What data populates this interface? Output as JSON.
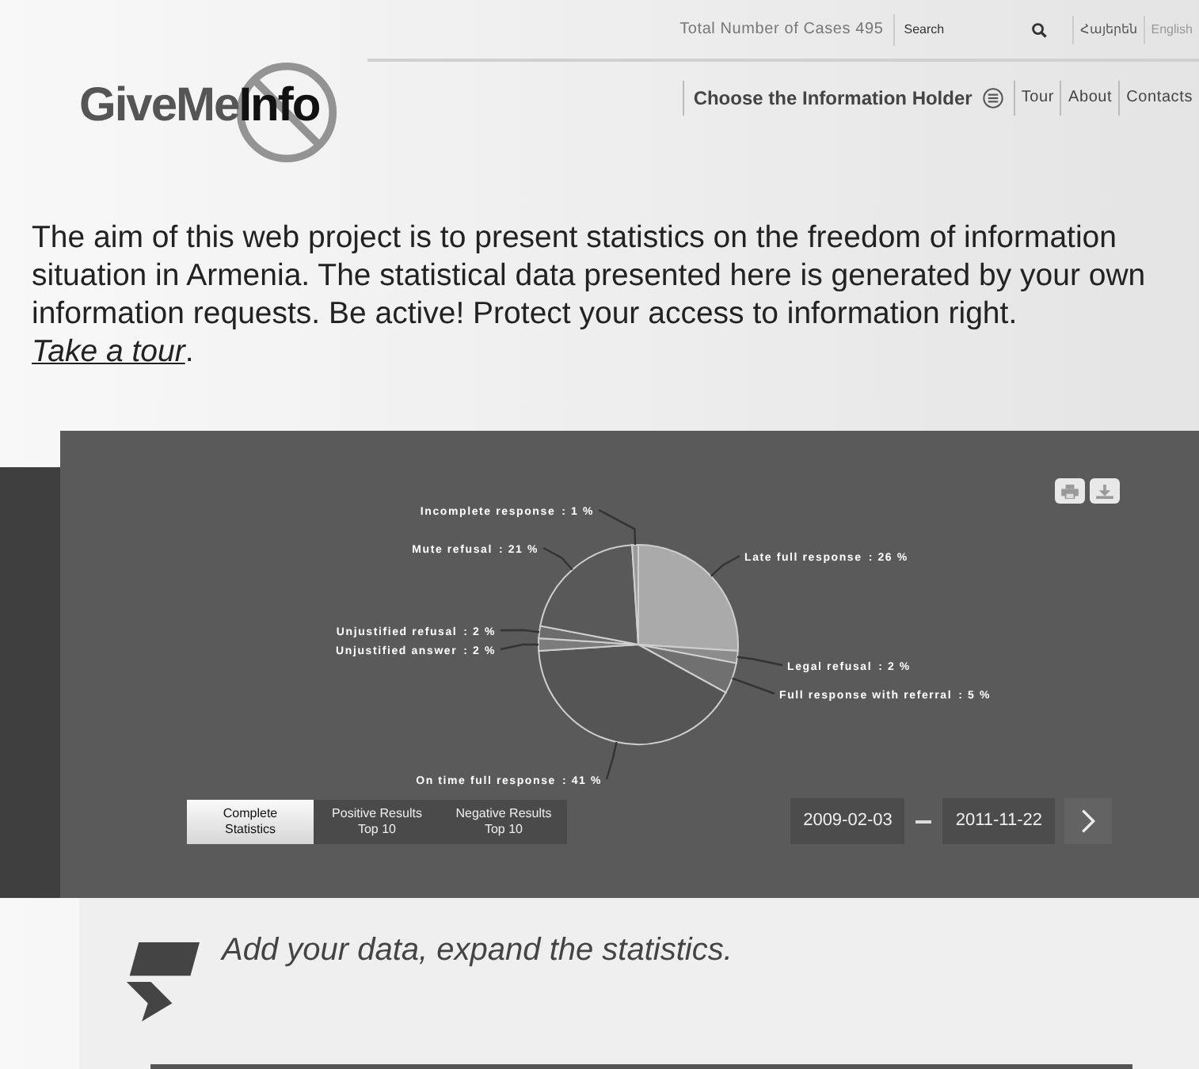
{
  "header": {
    "logo": "GiveMe**Info**",
    "cases": "Total Number of Cases 495",
    "search": {
      "placeholder": "Search"
    },
    "languages": [
      {
        "label": "Հայերեն",
        "selected": false
      },
      {
        "label": "English",
        "selected": true
      }
    ],
    "holder_menu": "Choose the Information Holder",
    "nav": [
      "Tour",
      "About",
      "Contacts"
    ]
  },
  "intro": {
    "text": "The aim of this web project is to present statistics on the freedom of information situation in Armenia. The statistical data presented here is generated by your own information requests. Be active! Protect your access to information right. ",
    "link": "Take a tour",
    "after": "."
  },
  "chart_data": {
    "type": "pie",
    "categories": [
      "Late full response",
      "Legal refusal",
      "Full response with referral",
      "On time full response",
      "Unjustified answer",
      "Unjustified refusal",
      "Mute refusal",
      "Incomplete response"
    ],
    "values": [
      26,
      2,
      5,
      41,
      2,
      2,
      21,
      1
    ],
    "value_labels": [
      ": 26 %",
      ": 2 %",
      ": 5 %",
      ": 41 %",
      ": 2 %",
      ": 2 %",
      ": 21 %",
      ": 1 %"
    ]
  },
  "stat_tabs": [
    {
      "label": "Complete Statistics",
      "selected": true
    },
    {
      "label": "Positive Results Top 10",
      "selected": false
    },
    {
      "label": "Negative Results Top 10",
      "selected": false
    }
  ],
  "date_from": "2009-02-03",
  "date_to": "2011-11-22",
  "call_to_action": "Add your data, expand the statistics."
}
